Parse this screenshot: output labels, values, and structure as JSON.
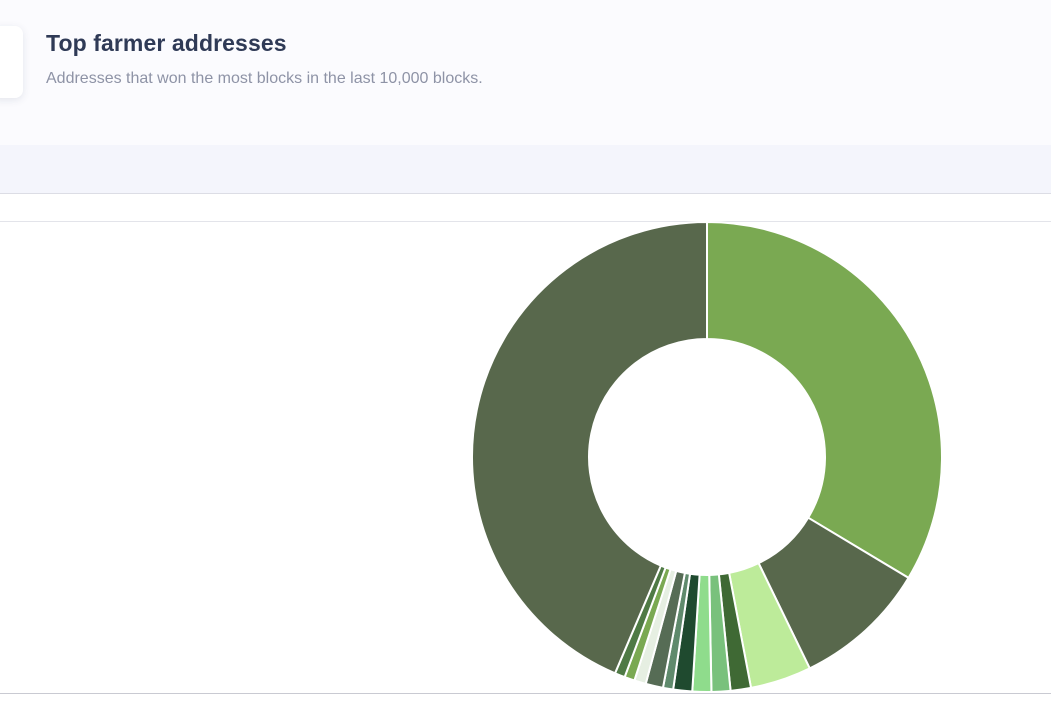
{
  "header": {
    "title": "Top farmer addresses",
    "subtitle": "Addresses that won the most blocks in the last 10,000 blocks."
  },
  "chart_data": {
    "type": "pie",
    "variant": "donut",
    "title": "",
    "legend": "none",
    "values": [
      33.6,
      9.2,
      4.2,
      1.4,
      1.3,
      1.3,
      1.3,
      0.7,
      1.2,
      0.8,
      0.7,
      0.7,
      43.6
    ],
    "colors": [
      "#7aa952",
      "#58684c",
      "#bdeb9a",
      "#3f6934",
      "#79c17c",
      "#8fdc8c",
      "#1f4a2f",
      "#5f8a6c",
      "#566c55",
      "#e6efe2",
      "#7aa952",
      "#4f7a45",
      "#58684c"
    ]
  }
}
